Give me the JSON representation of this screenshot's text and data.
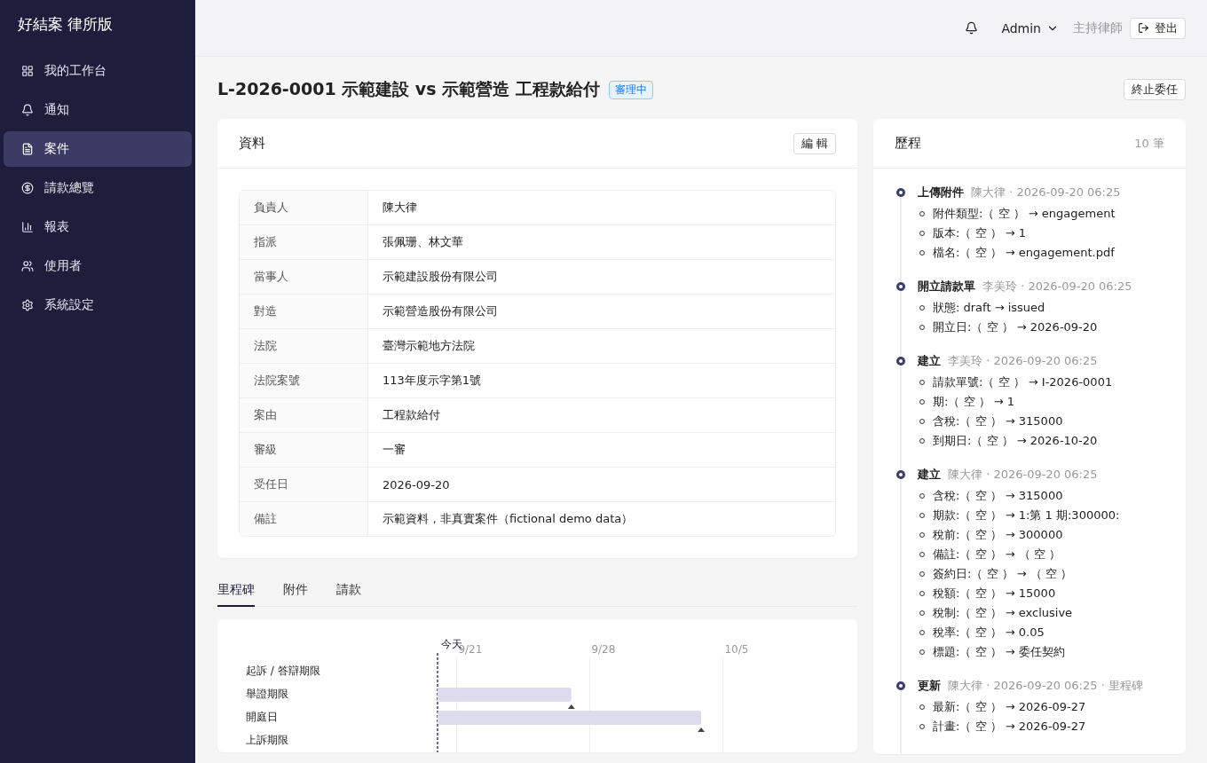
{
  "sidebar": {
    "brand": "好結案 律所版",
    "items": [
      {
        "label": "我的工作台",
        "selected": false
      },
      {
        "label": "通知",
        "selected": false
      },
      {
        "label": "案件",
        "selected": true
      },
      {
        "label": "請款總覽",
        "selected": false
      },
      {
        "label": "報表",
        "selected": false
      },
      {
        "label": "使用者",
        "selected": false
      },
      {
        "label": "系統設定",
        "selected": false
      }
    ]
  },
  "header": {
    "user": "Admin",
    "role": "主持律師",
    "logout": "登出"
  },
  "case": {
    "title": "L-2026-0001 示範建設 vs 示範營造 工程款給付",
    "status": "審理中",
    "terminate_button": "終止委任"
  },
  "info": {
    "title": "資料",
    "edit_button": "編 輯",
    "rows": [
      {
        "label": "負責人",
        "value": "陳大律"
      },
      {
        "label": "指派",
        "value": "張佩珊、林文華"
      },
      {
        "label": "當事人",
        "value": "示範建設股份有限公司"
      },
      {
        "label": "對造",
        "value": "示範營造股份有限公司"
      },
      {
        "label": "法院",
        "value": "臺灣示範地方法院"
      },
      {
        "label": "法院案號",
        "value": "113年度示字第1號"
      },
      {
        "label": "案由",
        "value": "工程款給付"
      },
      {
        "label": "審級",
        "value": "一審"
      },
      {
        "label": "受任日",
        "value": "2026-09-20"
      },
      {
        "label": "備註",
        "value": "示範資料，非真實案件（fictional demo data）"
      }
    ]
  },
  "tabs": [
    {
      "label": "里程碑",
      "selected": true
    },
    {
      "label": "附件",
      "selected": false
    },
    {
      "label": "請款",
      "selected": false
    }
  ],
  "milestones": {
    "today": "今天",
    "ticks": [
      "9/21",
      "9/28",
      "10/5"
    ],
    "rows": [
      {
        "label": "起訴 / 答辯期限"
      },
      {
        "label": "舉證期限",
        "level": 0.33
      },
      {
        "label": "開庭日",
        "level": 0.65
      },
      {
        "label": "上訴期限"
      }
    ]
  },
  "history": {
    "title": "歷程",
    "count": "10 筆",
    "entries": [
      {
        "action": "上傳附件",
        "meta": "陳大律 · 2026-09-20 06:25",
        "changes": [
          "附件類型:（ 空 ） → engagement",
          "版本:（ 空 ） → 1",
          "檔名:（ 空 ） → engagement.pdf"
        ]
      },
      {
        "action": "開立請款單",
        "meta": "李美玲 · 2026-09-20 06:25",
        "changes": [
          "狀態: draft → issued",
          "開立日:（ 空 ） → 2026-09-20"
        ]
      },
      {
        "action": "建立",
        "meta": "李美玲 · 2026-09-20 06:25",
        "changes": [
          "請款單號:（ 空 ） → I-2026-0001",
          "期:（ 空 ） → 1",
          "含稅:（ 空 ） → 315000",
          "到期日:（ 空 ） → 2026-10-20"
        ]
      },
      {
        "action": "建立",
        "meta": "陳大律 · 2026-09-20 06:25",
        "changes": [
          "含稅:（ 空 ） → 315000",
          "期款:（ 空 ） → 1:第 1 期:300000:",
          "稅前:（ 空 ） → 300000",
          "備註:（ 空 ） → （ 空 ）",
          "簽約日:（ 空 ） → （ 空 ）",
          "稅額:（ 空 ） → 15000",
          "稅制:（ 空 ） → exclusive",
          "稅率:（ 空 ） → 0.05",
          "標題:（ 空 ） → 委任契約"
        ]
      },
      {
        "action": "更新",
        "meta": "陳大律 · 2026-09-20 06:25 · 里程碑",
        "changes": [
          "最新:（ 空 ） → 2026-09-27",
          "計畫:（ 空 ） → 2026-09-27"
        ]
      }
    ]
  }
}
